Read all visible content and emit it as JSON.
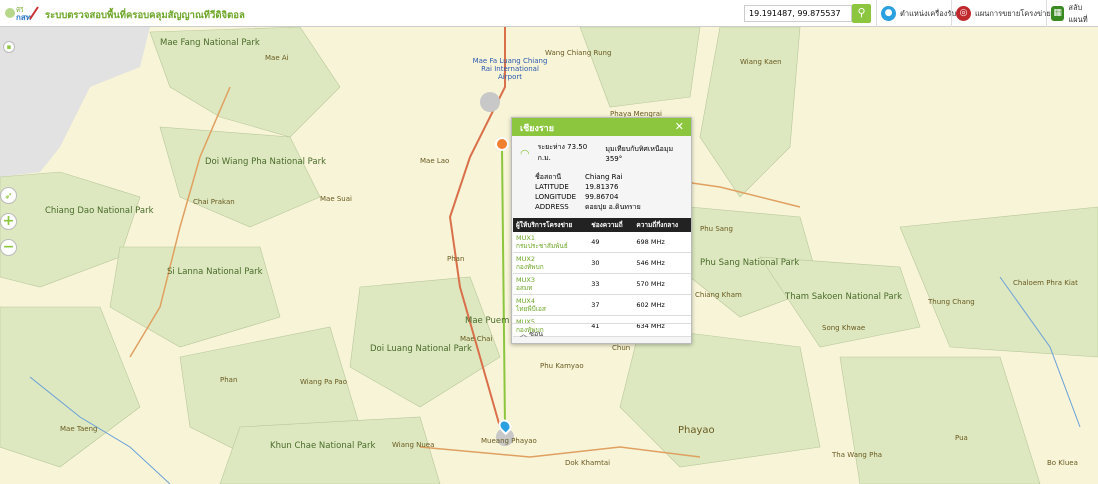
{
  "header": {
    "title": "ระบบตรวจสอบพื้นที่ครอบคลุมสัญญาณทีวีดิจิตอล",
    "logo_text": "ทีวีดิจิตอล กสทช",
    "search_value": "19.191487, 99.875537",
    "buttons": [
      {
        "label": "ตำแหน่งเครื่องรับ",
        "icon": "location-pin-icon"
      },
      {
        "label": "แผนการขยายโครงข่าย",
        "icon": "network-plan-icon"
      },
      {
        "label": "สลับแผนที่",
        "icon": "map-switch-icon"
      }
    ]
  },
  "map": {
    "labels": [
      {
        "t": "Mae Fang National Park",
        "c": "park"
      },
      {
        "t": "Doi Wiang Pha National Park",
        "c": "park"
      },
      {
        "t": "Chiang Dao National Park",
        "c": "park"
      },
      {
        "t": "Si Lanna National Park",
        "c": "park"
      },
      {
        "t": "Doi Luang National Park",
        "c": "park"
      },
      {
        "t": "Khun Chae National Park",
        "c": "park"
      },
      {
        "t": "Phu Sang National Park",
        "c": "park"
      },
      {
        "t": "Tham Sakoen National Park",
        "c": "park"
      },
      {
        "t": "Mae Puem National Park",
        "c": "park"
      },
      {
        "t": "Mae Fa Luang Chiang Rai International Airport",
        "c": "air"
      },
      {
        "t": "Mae Ai",
        "c": "l"
      },
      {
        "t": "Mae Lao",
        "c": "l"
      },
      {
        "t": "Mae Suai",
        "c": "l"
      },
      {
        "t": "Chai Prakan",
        "c": "l"
      },
      {
        "t": "Phan",
        "c": "l"
      },
      {
        "t": "Mae Chai",
        "c": "l"
      },
      {
        "t": "Wiang Pa Pao",
        "c": "l"
      },
      {
        "t": "Phan",
        "c": "l"
      },
      {
        "t": "Mae Taeng",
        "c": "l"
      },
      {
        "t": "Wiang Nuea",
        "c": "l"
      },
      {
        "t": "Mueang Phayao",
        "c": "l"
      },
      {
        "t": "Phu Kamyao",
        "c": "l"
      },
      {
        "t": "Phayao",
        "c": "big"
      },
      {
        "t": "Dok Khamtai",
        "c": "l"
      },
      {
        "t": "Wang Chiang Rung",
        "c": "l"
      },
      {
        "t": "Phaya Mengrai",
        "c": "l"
      },
      {
        "t": "Wiang Kaen",
        "c": "l"
      },
      {
        "t": "Phu Sang",
        "c": "l"
      },
      {
        "t": "Chiang Kham",
        "c": "l"
      },
      {
        "t": "Song Khwae",
        "c": "l"
      },
      {
        "t": "Thung Chang",
        "c": "l"
      },
      {
        "t": "Chaloem Phra Kiat",
        "c": "l"
      },
      {
        "t": "Chun",
        "c": "l"
      },
      {
        "t": "Tha Wang Pha",
        "c": "l"
      },
      {
        "t": "Pua",
        "c": "l"
      },
      {
        "t": "Bo Kluea",
        "c": "l"
      }
    ]
  },
  "controls": {
    "compass": "compass-icon",
    "zoom_in": "+",
    "zoom_out": "−"
  },
  "popup": {
    "title": "เชียงราย",
    "distance": "ระยะห่าง 73.50 ก.ม.",
    "azimuth": "มุมเทียบกับทิศเหนือมุม 359°",
    "fields": [
      {
        "k": "ชื่อสถานี",
        "v": "Chiang Rai"
      },
      {
        "k": "LATITUDE",
        "v": "19.81376"
      },
      {
        "k": "LONGITUDE",
        "v": "99.86704"
      },
      {
        "k": "ADDRESS",
        "v": "ดอยปุย อ.ดินทราย"
      }
    ],
    "columns": [
      "ผู้ให้บริการโครงข่าย",
      "ช่องความถี่",
      "ความถี่กึ่งกลาง"
    ],
    "rows": [
      {
        "mux": "MUX1",
        "op": "กรมประชาสัมพันธ์",
        "ch": "49",
        "f": "698 MHz"
      },
      {
        "mux": "MUX2",
        "op": "กองทัพบก",
        "ch": "30",
        "f": "546 MHz"
      },
      {
        "mux": "MUX3",
        "op": "อสมท",
        "ch": "33",
        "f": "570 MHz"
      },
      {
        "mux": "MUX4",
        "op": "ไทยพีบีเอส",
        "ch": "37",
        "f": "602 MHz"
      },
      {
        "mux": "MUX5",
        "op": "กองทัพบก",
        "ch": "41",
        "f": "634 MHz"
      }
    ],
    "hide_label": "ซ่อน"
  },
  "colors": {
    "accent": "#8cc63f",
    "park": "#dde8c0",
    "land": "#f7f4d8"
  }
}
